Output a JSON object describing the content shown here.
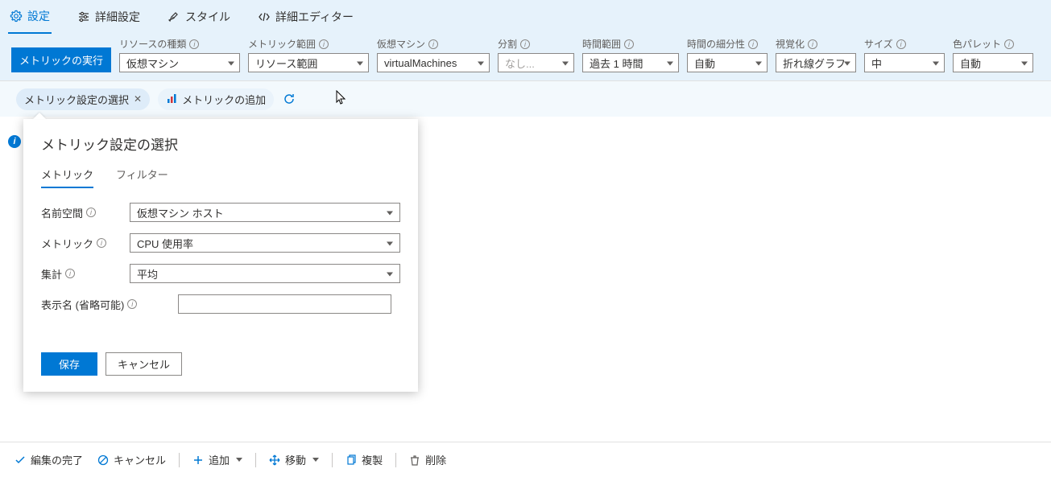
{
  "tabs": {
    "settings": "設定",
    "advanced": "詳細設定",
    "style": "スタイル",
    "editor": "詳細エディター"
  },
  "runButton": "メトリックの実行",
  "params": {
    "resourceType": {
      "label": "リソースの種類",
      "value": "仮想マシン"
    },
    "metricScope": {
      "label": "メトリック範囲",
      "value": "リソース範囲"
    },
    "vm": {
      "label": "仮想マシン",
      "value": "virtualMachines"
    },
    "split": {
      "label": "分割",
      "value": "なし..."
    },
    "timeRange": {
      "label": "時間範囲",
      "value": "過去 1 時間"
    },
    "granularity": {
      "label": "時間の細分性",
      "value": "自動"
    },
    "visualization": {
      "label": "視覚化",
      "value": "折れ線グラフ"
    },
    "size": {
      "label": "サイズ",
      "value": "中"
    },
    "palette": {
      "label": "色パレット",
      "value": "自動"
    }
  },
  "pills": {
    "selectMetric": "メトリック設定の選択",
    "addMetric": "メトリックの追加"
  },
  "popup": {
    "title": "メトリック設定の選択",
    "tabs": {
      "metric": "メトリック",
      "filter": "フィルター"
    },
    "fields": {
      "namespace": {
        "label": "名前空間",
        "value": "仮想マシン ホスト"
      },
      "metric": {
        "label": "メトリック",
        "value": "CPU 使用率"
      },
      "aggregation": {
        "label": "集計",
        "value": "平均"
      },
      "displayName": {
        "label": "表示名 (省略可能)",
        "value": ""
      }
    },
    "save": "保存",
    "cancel": "キャンセル"
  },
  "bottomBar": {
    "done": "編集の完了",
    "cancel": "キャンセル",
    "add": "追加",
    "move": "移動",
    "duplicate": "複製",
    "delete": "削除"
  }
}
